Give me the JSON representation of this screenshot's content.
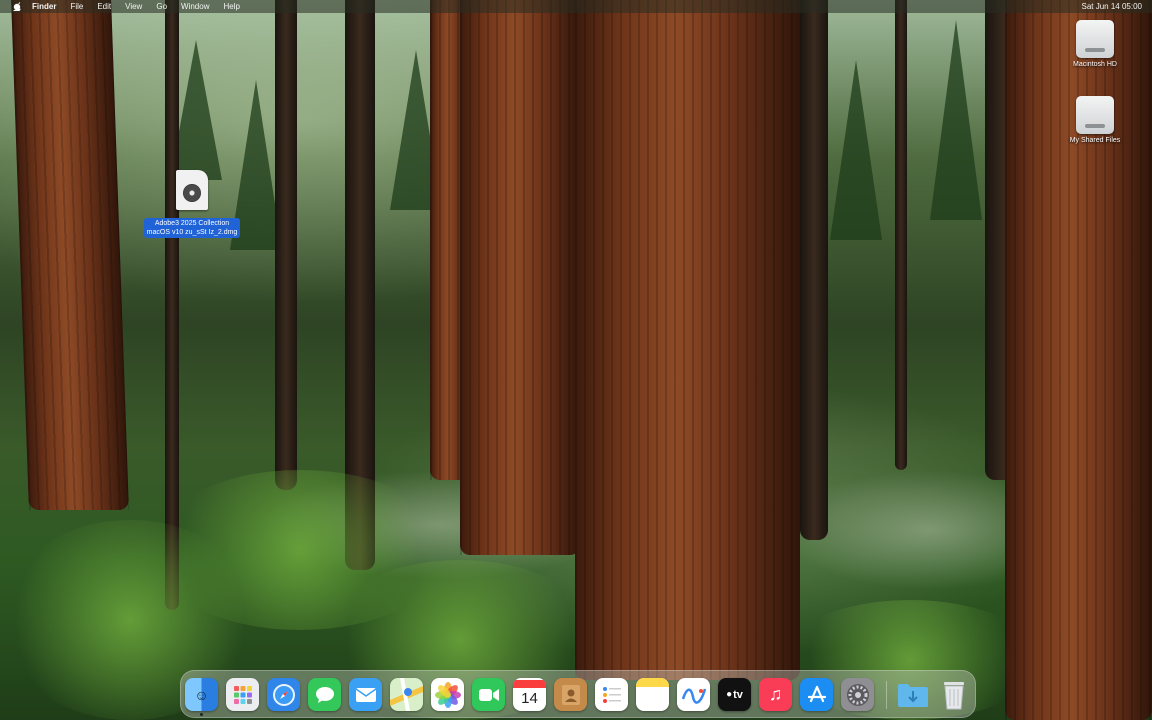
{
  "menubar": {
    "app_name": "Finder",
    "menus": [
      "File",
      "Edit",
      "View",
      "Go",
      "Window",
      "Help"
    ],
    "clock": "Sat Jun 14  05:00"
  },
  "desktop": {
    "icons": [
      {
        "label": "Macintosh HD",
        "icon": "hard-disk-icon"
      },
      {
        "label": "My Shared Files",
        "icon": "hard-disk-icon"
      }
    ],
    "selected_file": {
      "label_line1": "Adobe3 2025 Collection",
      "label_line2": "macOS v10 zu_sSt Iz_2.dmg",
      "icon": "dmg-file-icon"
    }
  },
  "dock": {
    "apps": [
      {
        "name": "Finder",
        "icon": "finder-icon",
        "color": "#3b8ff0"
      },
      {
        "name": "Launchpad",
        "icon": "launchpad-icon",
        "color": "#e7e7ea"
      },
      {
        "name": "Safari",
        "icon": "safari-icon",
        "color": "#2f86e8"
      },
      {
        "name": "Messages",
        "icon": "messages-icon",
        "color": "#34c759"
      },
      {
        "name": "Mail",
        "icon": "mail-icon",
        "color": "#3aa0f3"
      },
      {
        "name": "Maps",
        "icon": "maps-icon",
        "color": "#6cc26a"
      },
      {
        "name": "Photos",
        "icon": "photos-icon",
        "color": "#ffffff"
      },
      {
        "name": "FaceTime",
        "icon": "facetime-icon",
        "color": "#30c85a"
      },
      {
        "name": "Calendar",
        "icon": "calendar-icon",
        "color": "#ffffff",
        "text": "14"
      },
      {
        "name": "Contacts",
        "icon": "contacts-icon",
        "color": "#c48a4a"
      },
      {
        "name": "Reminders",
        "icon": "reminders-icon",
        "color": "#ffffff"
      },
      {
        "name": "Notes",
        "icon": "notes-icon",
        "color": "#ffd84a"
      },
      {
        "name": "Freeform",
        "icon": "freeform-icon",
        "color": "#ffffff"
      },
      {
        "name": "TV",
        "icon": "tv-icon",
        "color": "#111111",
        "text": "tv"
      },
      {
        "name": "Music",
        "icon": "music-icon",
        "color": "#fa3d56"
      },
      {
        "name": "App Store",
        "icon": "app-store-icon",
        "color": "#1c8ef3"
      },
      {
        "name": "System Settings",
        "icon": "settings-icon",
        "color": "#8e8e93"
      }
    ],
    "trailing": [
      {
        "name": "Downloads",
        "icon": "downloads-folder-icon",
        "color": "#5fb7ec"
      },
      {
        "name": "Trash",
        "icon": "trash-icon",
        "color": "#e6e9ec"
      }
    ]
  }
}
